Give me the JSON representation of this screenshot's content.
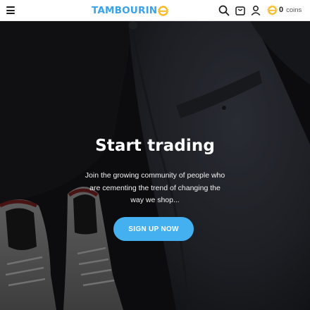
{
  "header": {
    "brand": "TAMBOURIN",
    "coins_count": "0",
    "coins_label": "coins",
    "icons": [
      "menu-icon",
      "search-icon",
      "shopping-bag-icon",
      "user-icon",
      "coin-icon"
    ]
  },
  "hero": {
    "title": "Start trading",
    "subtitle": "Join the growing community of people who are cementing the trend of changing the way we shop...",
    "cta_label": "SIGN UP NOW"
  },
  "colors": {
    "brand_blue": "#3aa3e8",
    "brand_yellow": "#f5b820",
    "cta_blue": "#45b0f0",
    "header_bg": "#ffffff",
    "hero_bg": "#0f1012"
  }
}
